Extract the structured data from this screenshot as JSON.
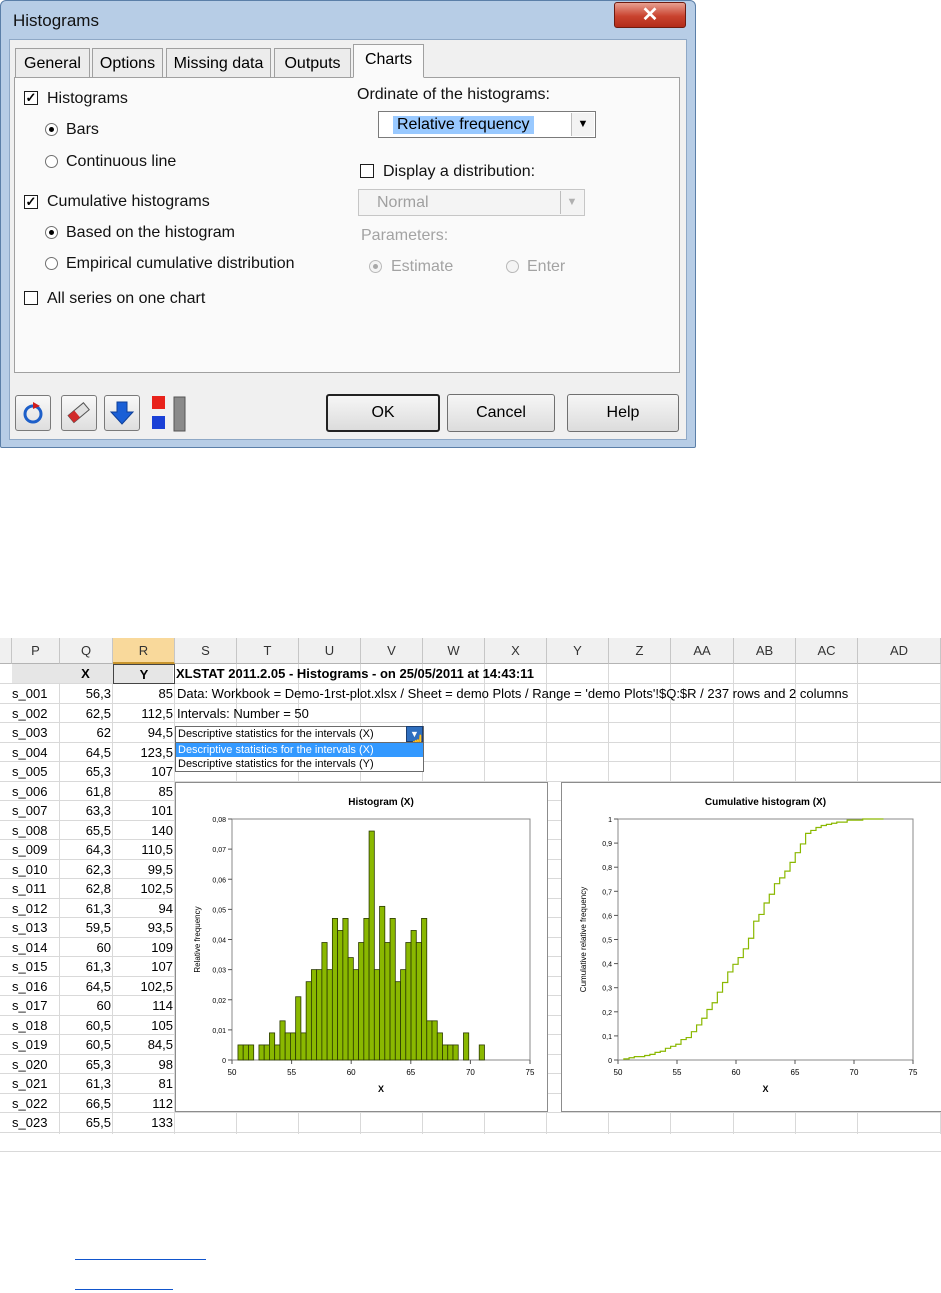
{
  "dialog": {
    "title": "Histograms",
    "close_glyph": "✕",
    "tabs": [
      "General",
      "Options",
      "Missing data",
      "Outputs",
      "Charts"
    ],
    "active_tab": "Charts",
    "histograms": {
      "label": "Histograms",
      "checked": true,
      "options": [
        {
          "label": "Bars",
          "selected": true
        },
        {
          "label": "Continuous line",
          "selected": false
        }
      ]
    },
    "cumulative": {
      "label": "Cumulative histograms",
      "checked": true,
      "options": [
        {
          "label": "Based on the histogram",
          "selected": true
        },
        {
          "label": "Empirical cumulative distribution",
          "selected": false
        }
      ]
    },
    "all_series": {
      "label": "All series on one chart",
      "checked": false
    },
    "ordinate_label": "Ordinate of the histograms:",
    "ordinate_value": "Relative frequency",
    "display_distribution": {
      "label": "Display a distribution:",
      "checked": false
    },
    "distribution_value": "Normal",
    "parameters_label": "Parameters:",
    "parameters_options": [
      {
        "label": "Estimate",
        "selected": true
      },
      {
        "label": "Enter",
        "selected": false
      }
    ],
    "buttons": {
      "ok": "OK",
      "cancel": "Cancel",
      "help": "Help"
    },
    "toolbar_icons": [
      "reset-icon",
      "eraser-icon",
      "down-arrow-icon",
      "color-blocks-icon"
    ],
    "colors": {
      "accent_red": "#e8221b",
      "accent_blue": "#1a5fd6",
      "selection": "#99c9ff"
    }
  },
  "sheet": {
    "columns": [
      "P",
      "Q",
      "R",
      "S",
      "T",
      "U",
      "V",
      "W",
      "X",
      "Y",
      "Z",
      "AA",
      "AB",
      "AC",
      "AD"
    ],
    "selected_column": "R",
    "headers": {
      "x": "X",
      "y": "Y"
    },
    "rows": [
      [
        "s_001",
        "56,3",
        "85"
      ],
      [
        "s_002",
        "62,5",
        "112,5"
      ],
      [
        "s_003",
        "62",
        "94,5"
      ],
      [
        "s_004",
        "64,5",
        "123,5"
      ],
      [
        "s_005",
        "65,3",
        "107"
      ],
      [
        "s_006",
        "61,8",
        "85"
      ],
      [
        "s_007",
        "63,3",
        "101"
      ],
      [
        "s_008",
        "65,5",
        "140"
      ],
      [
        "s_009",
        "64,3",
        "110,5"
      ],
      [
        "s_010",
        "62,3",
        "99,5"
      ],
      [
        "s_011",
        "62,8",
        "102,5"
      ],
      [
        "s_012",
        "61,3",
        "94"
      ],
      [
        "s_013",
        "59,5",
        "93,5"
      ],
      [
        "s_014",
        "60",
        "109"
      ],
      [
        "s_015",
        "61,3",
        "107"
      ],
      [
        "s_016",
        "64,5",
        "102,5"
      ],
      [
        "s_017",
        "60",
        "114"
      ],
      [
        "s_018",
        "60,5",
        "105"
      ],
      [
        "s_019",
        "60,5",
        "84,5"
      ],
      [
        "s_020",
        "65,3",
        "98"
      ],
      [
        "s_021",
        "61,3",
        "81"
      ],
      [
        "s_022",
        "66,5",
        "112"
      ],
      [
        "s_023",
        "65,5",
        "133"
      ]
    ],
    "report_title": "XLSTAT 2011.2.05 - Histograms - on 25/05/2011 at 14:43:11",
    "data_line": "Data: Workbook = Demo-1rst-plot.xlsx / Sheet = demo Plots / Range = 'demo Plots'!$Q:$R / 237 rows and 2 columns",
    "intervals_line": "Intervals:  Number = 50",
    "dropdown": {
      "value": "Descriptive statistics for the intervals (X)",
      "options": [
        "Descriptive statistics for the intervals (X)",
        "Descriptive statistics for the intervals (Y)"
      ],
      "highlighted": 0
    }
  },
  "chart_data": [
    {
      "type": "bar",
      "title": "Histogram (X)",
      "xlabel": "X",
      "ylabel": "Relative frequency",
      "xlim": [
        50,
        75
      ],
      "ylim": [
        0,
        0.08
      ],
      "xticks": [
        "50",
        "55",
        "60",
        "65",
        "70",
        "75"
      ],
      "yticks": [
        "0",
        "0,01",
        "0,02",
        "0,03",
        "0,04",
        "0,05",
        "0,06",
        "0,07",
        "0,08"
      ],
      "bin_start": 50.5,
      "bin_width": 0.44,
      "values": [
        0.005,
        0.005,
        0.005,
        0,
        0.005,
        0.005,
        0.009,
        0.005,
        0.013,
        0.009,
        0.009,
        0.021,
        0.009,
        0.026,
        0.03,
        0.03,
        0.039,
        0.03,
        0.047,
        0.043,
        0.047,
        0.034,
        0.03,
        0.039,
        0.047,
        0.076,
        0.03,
        0.051,
        0.039,
        0.047,
        0.026,
        0.03,
        0.039,
        0.043,
        0.039,
        0.047,
        0.013,
        0.013,
        0.009,
        0.005,
        0.005,
        0.005,
        0,
        0.009,
        0,
        0,
        0.005,
        0,
        0,
        0
      ],
      "bar_color": "#8ab800"
    },
    {
      "type": "line",
      "title": "Cumulative histogram (X)",
      "xlabel": "X",
      "ylabel": "Cumulative relative frequency",
      "xlim": [
        50,
        75
      ],
      "ylim": [
        0,
        1
      ],
      "xticks": [
        "50",
        "55",
        "60",
        "65",
        "70",
        "75"
      ],
      "yticks": [
        "0",
        "0,1",
        "0,2",
        "0,3",
        "0,4",
        "0,5",
        "0,6",
        "0,7",
        "0,8",
        "0,9",
        "1"
      ],
      "line_color": "#8ab800",
      "step": true
    }
  ],
  "links": [
    "",
    ""
  ]
}
